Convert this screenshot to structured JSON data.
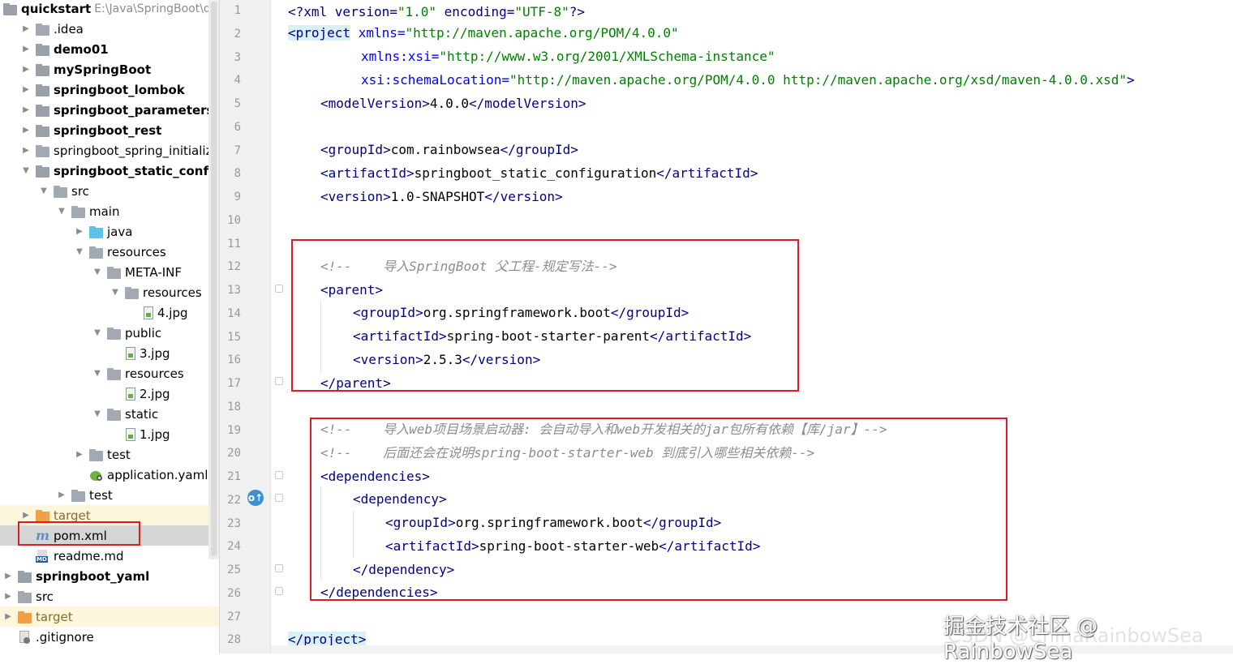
{
  "project_tree": {
    "rows": [
      {
        "label": "quickstart",
        "path": "E:\\Java\\SpringBoot\\qu",
        "bold": true,
        "arrow": "",
        "icon": "project-folder-icon"
      },
      {
        "label": ".idea",
        "bold": false,
        "arrow": "▶",
        "icon": "folder-icon"
      },
      {
        "label": "demo01",
        "bold": true,
        "arrow": "▶",
        "icon": "module-folder-icon"
      },
      {
        "label": "mySpringBoot",
        "bold": true,
        "arrow": "▶",
        "icon": "module-folder-icon"
      },
      {
        "label": "springboot_lombok",
        "bold": true,
        "arrow": "▶",
        "icon": "module-folder-icon"
      },
      {
        "label": "springboot_parameters",
        "bold": true,
        "arrow": "▶",
        "icon": "module-folder-icon"
      },
      {
        "label": "springboot_rest",
        "bold": true,
        "arrow": "▶",
        "icon": "module-folder-icon"
      },
      {
        "label": "springboot_spring_initializr",
        "bold": false,
        "arrow": "▶",
        "icon": "folder-icon"
      },
      {
        "label": "springboot_static_configurati",
        "bold": true,
        "arrow": "▼",
        "icon": "module-folder-icon"
      },
      {
        "label": "src",
        "bold": false,
        "arrow": "▼",
        "icon": "folder-icon"
      },
      {
        "label": "main",
        "bold": false,
        "arrow": "▼",
        "icon": "folder-icon"
      },
      {
        "label": "java",
        "bold": false,
        "arrow": "▶",
        "icon": "source-folder-icon"
      },
      {
        "label": "resources",
        "bold": false,
        "arrow": "▼",
        "icon": "resources-folder-icon"
      },
      {
        "label": "META-INF",
        "bold": false,
        "arrow": "▼",
        "icon": "folder-icon"
      },
      {
        "label": "resources",
        "bold": false,
        "arrow": "▼",
        "icon": "folder-icon"
      },
      {
        "label": "4.jpg",
        "bold": false,
        "arrow": "",
        "icon": "image-file-icon"
      },
      {
        "label": "public",
        "bold": false,
        "arrow": "▼",
        "icon": "folder-icon"
      },
      {
        "label": "3.jpg",
        "bold": false,
        "arrow": "",
        "icon": "image-file-icon"
      },
      {
        "label": "resources",
        "bold": false,
        "arrow": "▼",
        "icon": "folder-icon"
      },
      {
        "label": "2.jpg",
        "bold": false,
        "arrow": "",
        "icon": "image-file-icon"
      },
      {
        "label": "static",
        "bold": false,
        "arrow": "▼",
        "icon": "folder-icon"
      },
      {
        "label": "1.jpg",
        "bold": false,
        "arrow": "",
        "icon": "image-file-icon"
      },
      {
        "label": "test",
        "bold": false,
        "arrow": "▶",
        "icon": "folder-icon"
      },
      {
        "label": "application.yaml",
        "bold": false,
        "arrow": "",
        "icon": "spring-yaml-icon"
      },
      {
        "label": "test",
        "bold": false,
        "arrow": "▶",
        "icon": "folder-icon"
      },
      {
        "label": "target",
        "bold": false,
        "arrow": "▶",
        "icon": "excluded-folder-icon"
      },
      {
        "label": "pom.xml",
        "bold": false,
        "arrow": "",
        "icon": "maven-icon"
      },
      {
        "label": "readme.md",
        "bold": false,
        "arrow": "",
        "icon": "markdown-icon"
      },
      {
        "label": "springboot_yaml",
        "bold": true,
        "arrow": "▶",
        "icon": "module-folder-icon"
      },
      {
        "label": "src",
        "bold": false,
        "arrow": "▶",
        "icon": "folder-icon"
      },
      {
        "label": "target",
        "bold": false,
        "arrow": "▶",
        "icon": "excluded-folder-icon"
      },
      {
        "label": ".gitignore",
        "bold": false,
        "arrow": "",
        "icon": "gitignore-icon"
      }
    ]
  },
  "editor": {
    "file": "pom.xml",
    "line_numbers": [
      "1",
      "2",
      "3",
      "4",
      "5",
      "6",
      "7",
      "8",
      "9",
      "10",
      "11",
      "12",
      "13",
      "14",
      "15",
      "16",
      "17",
      "18",
      "19",
      "20",
      "21",
      "22",
      "23",
      "24",
      "25",
      "26",
      "27",
      "28"
    ],
    "lines": {
      "l1": {
        "a": "<?xml version=",
        "b": "\"1.0\"",
        "c": " encoding=",
        "d": "\"UTF-8\"",
        "e": "?>"
      },
      "l2": {
        "a": "<project",
        "b": " xmlns=",
        "c": "\"http://maven.apache.org/POM/4.0.0\""
      },
      "l3": {
        "a": "xmlns:xsi=",
        "b": "\"http://www.w3.org/2001/XMLSchema-instance\""
      },
      "l4": {
        "a": "xsi:schemaLocation=",
        "b": "\"http://maven.apache.org/POM/4.0.0 http://maven.apache.org/xsd/maven-4.0.0.xsd\"",
        "c": ">"
      },
      "l5": {
        "open": "<modelVersion>",
        "text": "4.0.0",
        "close": "</modelVersion>"
      },
      "l7": {
        "open": "<groupId>",
        "text": "com.rainbowsea",
        "close": "</groupId>"
      },
      "l8": {
        "open": "<artifactId>",
        "text": "springboot_static_configuration",
        "close": "</artifactId>"
      },
      "l9": {
        "open": "<version>",
        "text": "1.0-SNAPSHOT",
        "close": "</version>"
      },
      "l12": {
        "comment": "<!--    导入SpringBoot 父工程-规定写法-->"
      },
      "l13": {
        "open": "<parent>"
      },
      "l14": {
        "open": "<groupId>",
        "text": "org.springframework.boot",
        "close": "</groupId>"
      },
      "l15": {
        "open": "<artifactId>",
        "text": "spring-boot-starter-parent",
        "close": "</artifactId>"
      },
      "l16": {
        "open": "<version>",
        "text": "2.5.3",
        "close": "</version>"
      },
      "l17": {
        "close": "</parent>"
      },
      "l19": {
        "comment": "<!--    导入web项目场景启动器: 会自动导入和web开发相关的jar包所有依赖【库/jar】-->"
      },
      "l20": {
        "comment": "<!--    后面还会在说明spring-boot-starter-web 到底引入哪些相关依赖-->"
      },
      "l21": {
        "open": "<dependencies>"
      },
      "l22": {
        "open": "<dependency>"
      },
      "l23": {
        "open": "<groupId>",
        "text": "org.springframework.boot",
        "close": "</groupId>"
      },
      "l24": {
        "open": "<artifactId>",
        "text": "spring-boot-starter-web",
        "close": "</artifactId>"
      },
      "l25": {
        "close": "</dependency>"
      },
      "l26": {
        "close": "</dependencies>"
      },
      "l28": {
        "close": "</project>"
      }
    }
  },
  "watermark": {
    "line1": "掘金技术社区 @ RainbowSea",
    "line2": "CSDN @ChinaRainbowSea"
  },
  "colors": {
    "tag": "#000080",
    "attr_name": "#0000ff",
    "attr_value": "#008000",
    "comment": "#8c8c8c",
    "highlight_box": "#e01b24",
    "selection": "#d5d5d5"
  }
}
